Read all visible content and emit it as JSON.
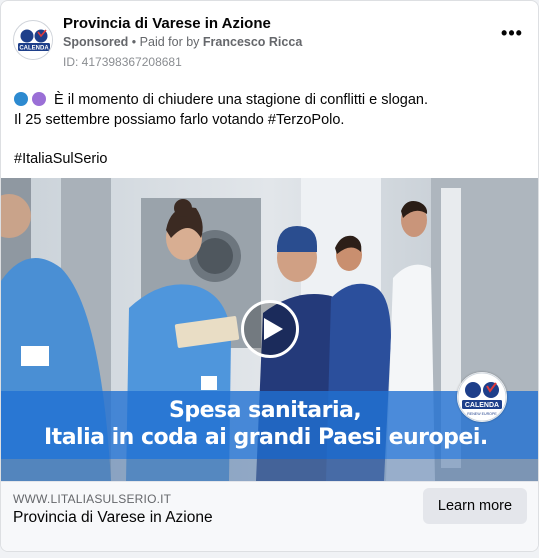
{
  "post": {
    "page_name": "Provincia di Varese in Azione",
    "sponsored": "Sponsored",
    "separator": "•",
    "paid_for_prefix": "Paid for by",
    "paid_for_name": "Francesco Ricca",
    "ad_id": "ID: 417398367208681",
    "more_icon": "more-horizontal-icon",
    "more_label": "•••",
    "text_line1": "È il momento di chiudere una stagione di conflitti e slogan.",
    "text_line2": "Il 25 settembre possiamo farlo votando #TerzoPolo.",
    "hashtag": "#ItaliaSulSerio",
    "emoji_colors": [
      "#2d8ad0",
      "#9a6fd6"
    ]
  },
  "logo": {
    "top": "Azione",
    "top_right": "Italia Viva",
    "name": "CALENDA",
    "bottom": "RENEW EUROPE"
  },
  "video": {
    "caption_line1": "Spesa sanitaria,",
    "caption_line2": "Italia in coda ai grandi Paesi europei.",
    "play_icon": "play-icon"
  },
  "link": {
    "domain": "WWW.LITALIASULSERIO.IT",
    "title": "Provincia di Varese in Azione",
    "cta": "Learn more"
  },
  "colors": {
    "scrub_blue": "#4a8fd4",
    "navy_scrub": "#243a7a",
    "caption_band": "#2070d2",
    "calenda_blue": "#1e3f8a"
  }
}
